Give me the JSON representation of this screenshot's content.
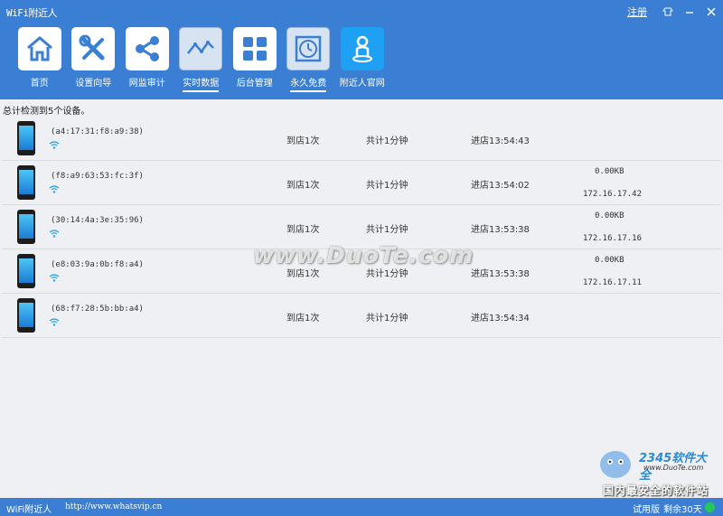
{
  "window": {
    "title": "WiFi附近人",
    "register_label": "注册"
  },
  "nav": [
    {
      "label": "首页",
      "icon": "home-icon"
    },
    {
      "label": "设置向导",
      "icon": "tools-icon"
    },
    {
      "label": "网监审计",
      "icon": "share-icon"
    },
    {
      "label": "实时数据",
      "icon": "line-chart-icon",
      "active": true
    },
    {
      "label": "后台管理",
      "icon": "grid-icon"
    },
    {
      "label": "永久免费",
      "icon": "clock-icon",
      "active": true
    },
    {
      "label": "附近人官网",
      "icon": "person-pin-icon"
    }
  ],
  "summary": "总计检测到5个设备。",
  "devices": [
    {
      "mac": "(a4:17:31:f8:a9:38)",
      "visits": "到店1次",
      "duration": "共计1分钟",
      "entry": "进店13:54:43",
      "traffic": "",
      "ip": ""
    },
    {
      "mac": "(f8:a9:63:53:fc:3f)",
      "visits": "到店1次",
      "duration": "共计1分钟",
      "entry": "进店13:54:02",
      "traffic": "0.00KB",
      "ip": "172.16.17.42"
    },
    {
      "mac": "(30:14:4a:3e:35:96)",
      "visits": "到店1次",
      "duration": "共计1分钟",
      "entry": "进店13:53:38",
      "traffic": "0.00KB",
      "ip": "172.16.17.16"
    },
    {
      "mac": "(e8:03:9a:0b:f8:a4)",
      "visits": "到店1次",
      "duration": "共计1分钟",
      "entry": "进店13:53:38",
      "traffic": "0.00KB",
      "ip": "172.16.17.11"
    },
    {
      "mac": "(68:f7:28:5b:bb:a4)",
      "visits": "到店1次",
      "duration": "共计1分钟",
      "entry": "进店13:54:34",
      "traffic": "",
      "ip": ""
    }
  ],
  "watermark": {
    "text": "www.DuoTe.com",
    "brand": "2345软件大全",
    "domain": "www.DuoTe.com",
    "slogan": "国内最安全的软件站"
  },
  "status": {
    "app": "WiFi附近人",
    "url": "http://www.whatsvip.cn",
    "trial": "试用版",
    "remaining": "剩余30天"
  },
  "colors": {
    "accent": "#3a7fd4",
    "status_dot": "#25c95a"
  }
}
